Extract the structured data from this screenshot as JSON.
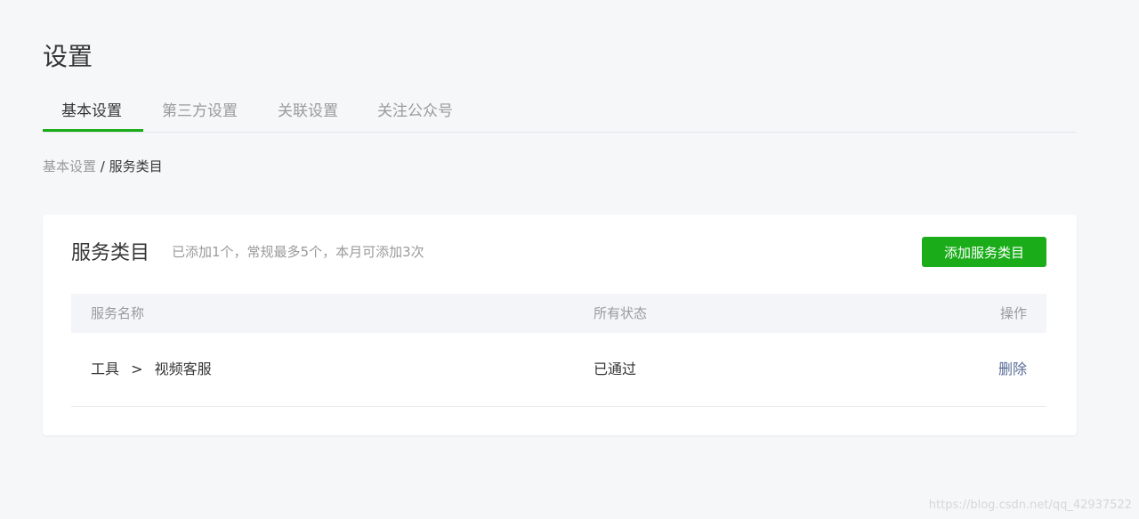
{
  "page": {
    "title": "设置"
  },
  "tabs": [
    {
      "label": "基本设置",
      "active": true
    },
    {
      "label": "第三方设置",
      "active": false
    },
    {
      "label": "关联设置",
      "active": false
    },
    {
      "label": "关注公众号",
      "active": false
    }
  ],
  "breadcrumb": {
    "parent": "基本设置",
    "separator": " / ",
    "current": "服务类目"
  },
  "card": {
    "title": "服务类目",
    "description": "已添加1个，常规最多5个，本月可添加3次",
    "add_button": "添加服务类目",
    "table": {
      "headers": {
        "name": "服务名称",
        "status": "所有状态",
        "action": "操作"
      },
      "rows": [
        {
          "category": "工具",
          "arrow": ">",
          "subcategory": "视频客服",
          "status": "已通过",
          "action": "删除"
        }
      ]
    }
  },
  "watermark": "https://blog.csdn.net/qq_42937522",
  "colors": {
    "accent": "#1aad19",
    "link": "#576b95",
    "muted": "#9a9a9a",
    "text": "#353535"
  }
}
